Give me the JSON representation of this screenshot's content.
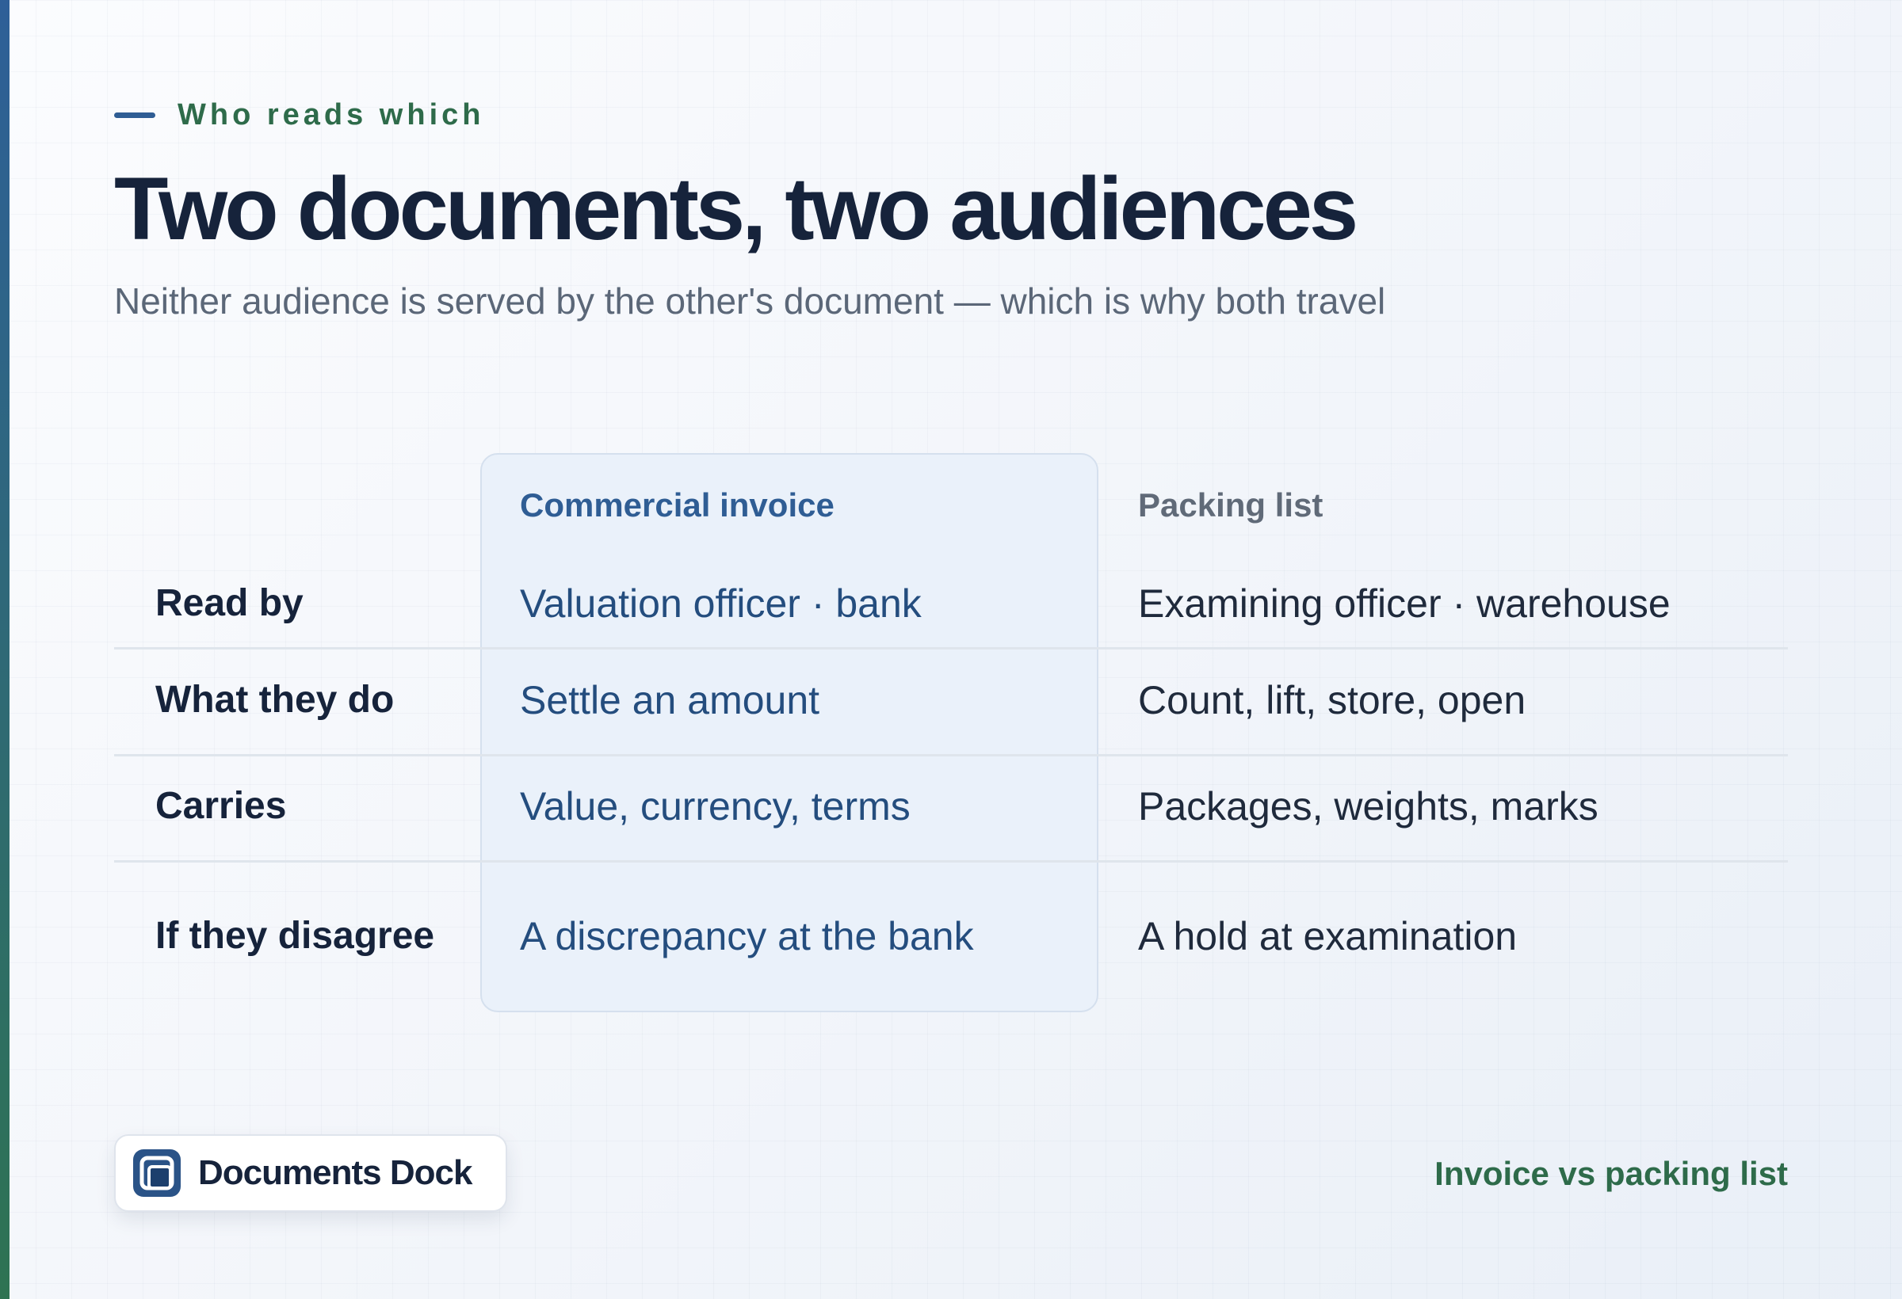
{
  "eyebrow": "Who reads which",
  "title": "Two documents, two audiences",
  "subtitle": "Neither audience is served by the other's document — which is why both travel",
  "comparison": {
    "columns": [
      "Commercial invoice",
      "Packing list"
    ],
    "rows": [
      {
        "label": "Read by",
        "invoice": "Valuation officer · bank",
        "packing": "Examining officer · warehouse"
      },
      {
        "label": "What they do",
        "invoice": "Settle an amount",
        "packing": "Count, lift, store, open"
      },
      {
        "label": "Carries",
        "invoice": "Value, currency, terms",
        "packing": "Packages, weights, marks"
      },
      {
        "label": "If they disagree",
        "invoice": "A discrepancy at the bank",
        "packing": "A hold at examination"
      }
    ]
  },
  "brand": {
    "name": "Documents Dock",
    "logo_icon": "document-stack-icon"
  },
  "footer_tag": "Invoice vs packing list",
  "colors": {
    "accent_blue": "#2f5d94",
    "accent_green": "#2e6b4a",
    "title": "#16233b",
    "highlight_bg": "#eaf1fa"
  }
}
